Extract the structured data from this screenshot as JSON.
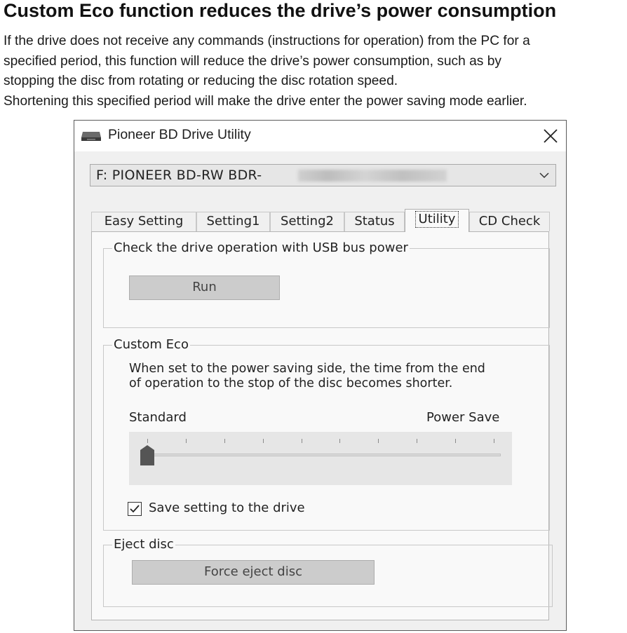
{
  "headline": "Custom Eco function reduces the drive’s power consumption",
  "intro": {
    "lines": [
      "If the drive does not receive any commands (instructions for operation) from the PC for a",
      "specified period, this function will reduce the drive’s power consumption, such as by",
      "stopping the disc from rotating or reducing the disc rotation speed.",
      "Shortening this specified period will make the drive enter the power saving mode earlier."
    ]
  },
  "window": {
    "title": "Pioneer BD Drive Utility",
    "icon": "drive-icon",
    "close_icon": "close-icon"
  },
  "drive_select": {
    "value": "F: PIONEER BD-RW  BDR-",
    "icon": "chevron-down-icon"
  },
  "tabs": [
    {
      "label": "Easy Setting"
    },
    {
      "label": "Setting1"
    },
    {
      "label": "Setting2"
    },
    {
      "label": "Status"
    },
    {
      "label": "Utility",
      "active": true
    },
    {
      "label": "CD Check"
    }
  ],
  "usb_group": {
    "legend": "Check the drive operation with USB bus power",
    "run_label": "Run"
  },
  "eco_group": {
    "legend": "Custom Eco",
    "description_lines": [
      "When set to the power saving side, the time from the end",
      "of operation to the stop of the disc becomes shorter."
    ],
    "slider_min_label": "Standard",
    "slider_max_label": "Power Save",
    "slider_steps": 10,
    "slider_value": 0,
    "checkbox_label": "Save setting to the drive",
    "checkbox_checked": true
  },
  "eject_group": {
    "legend": "Eject disc",
    "button_label": "Force eject disc"
  },
  "colors": {
    "window_bg": "#f0f0f0",
    "button_bg": "#cccccc",
    "slider_bg": "#e6e6e6",
    "thumb": "#555555"
  }
}
